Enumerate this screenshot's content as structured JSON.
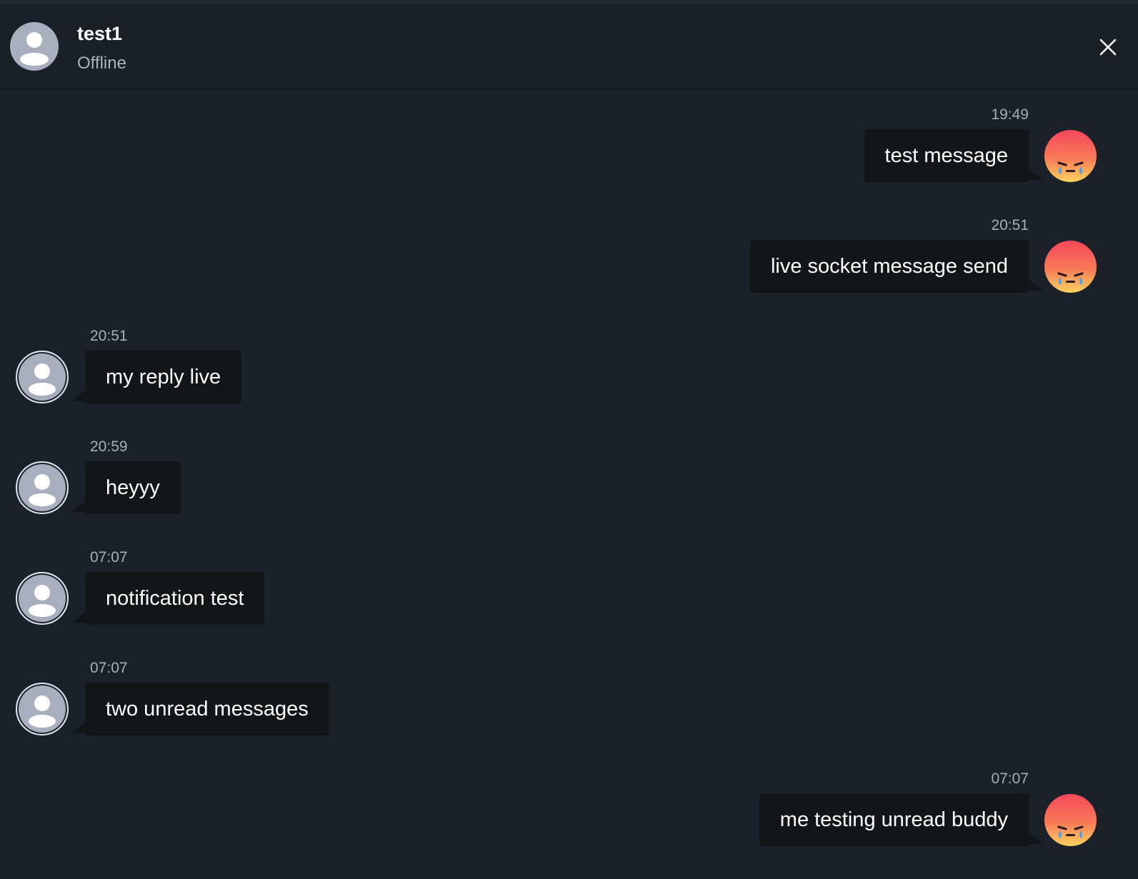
{
  "header": {
    "contact_name": "test1",
    "status": "Offline",
    "avatar_icon": "user-silhouette-icon",
    "close_icon": "close-icon"
  },
  "colors": {
    "background": "#1c2129",
    "bubble": "#131619",
    "avatar_placeholder": "#a7aebd",
    "emoji_gradient_top": "#f5475a",
    "emoji_gradient_bottom": "#fbd25e"
  },
  "messages": [
    {
      "direction": "outgoing",
      "time": "19:49",
      "text": "test message",
      "avatar": "crying-angry-emoji-icon"
    },
    {
      "direction": "outgoing",
      "time": "20:51",
      "text": "live socket message send",
      "avatar": "crying-angry-emoji-icon"
    },
    {
      "direction": "incoming",
      "time": "20:51",
      "text": "my reply live",
      "avatar": "user-silhouette-icon"
    },
    {
      "direction": "incoming",
      "time": "20:59",
      "text": "heyyy",
      "avatar": "user-silhouette-icon"
    },
    {
      "direction": "incoming",
      "time": "07:07",
      "text": "notification test",
      "avatar": "user-silhouette-icon"
    },
    {
      "direction": "incoming",
      "time": "07:07",
      "text": "two unread messages",
      "avatar": "user-silhouette-icon"
    },
    {
      "direction": "outgoing",
      "time": "07:07",
      "text": "me testing unread buddy",
      "avatar": "crying-angry-emoji-icon"
    }
  ]
}
